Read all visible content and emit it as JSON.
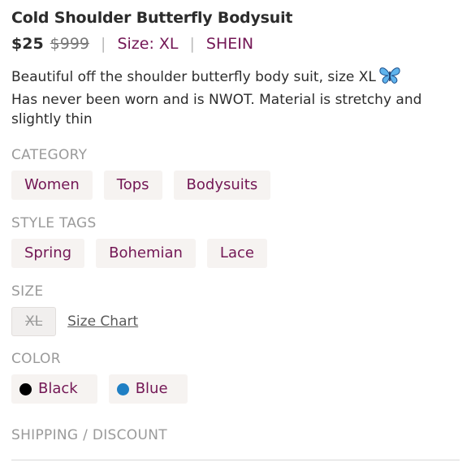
{
  "listing": {
    "title": "Cold Shoulder Butterfly Bodysuit",
    "price": "$25",
    "original_price": "$999",
    "size_text": "Size: XL",
    "brand": "SHEIN",
    "separator": "|"
  },
  "description": {
    "line1": "Beautiful off the shoulder butterfly body suit, size XL",
    "line2": "Has never been worn and is NWOT. Material is stretchy and",
    "line3": "slightly thin"
  },
  "category": {
    "label": "CATEGORY",
    "items": [
      "Women",
      "Tops",
      "Bodysuits"
    ]
  },
  "style_tags": {
    "label": "STYLE TAGS",
    "items": [
      "Spring",
      "Bohemian",
      "Lace"
    ]
  },
  "size": {
    "label": "SIZE",
    "value": "XL",
    "chart_link": "Size Chart"
  },
  "color": {
    "label": "COLOR",
    "items": [
      {
        "name": "Black",
        "swatch": "#000000"
      },
      {
        "name": "Blue",
        "swatch": "#1f7fc4"
      }
    ]
  },
  "shipping": {
    "label": "SHIPPING / DISCOUNT"
  },
  "theme": {
    "accent": "#731755",
    "chip_background": "#f6f3f1",
    "muted_label": "#9a9a9a",
    "butterfly_icon": "blue-butterfly-emoji"
  }
}
